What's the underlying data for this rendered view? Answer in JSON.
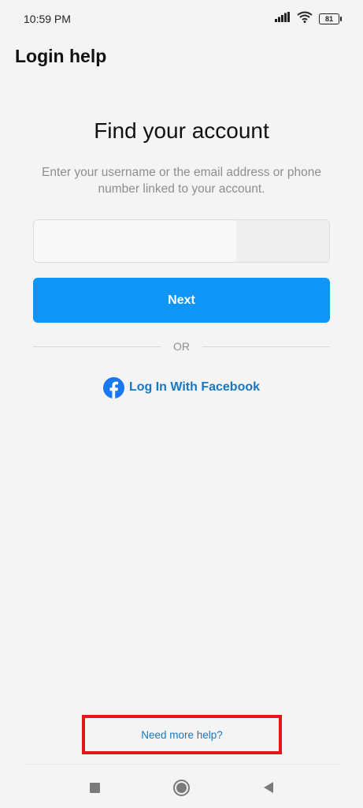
{
  "status_bar": {
    "time": "10:59 PM",
    "battery": "81",
    "icons": [
      "signal-icon",
      "wifi-icon",
      "battery-icon"
    ]
  },
  "header": {
    "title": "Login help"
  },
  "main": {
    "title": "Find your account",
    "subtitle": "Enter your username or the email address or phone number linked to your account.",
    "input": {
      "value": "",
      "placeholder": ""
    },
    "next_label": "Next",
    "divider_text": "OR",
    "facebook_label": "Log In With Facebook"
  },
  "footer": {
    "help_label": "Need more help?"
  },
  "nav": {
    "icons": [
      "recents-square-icon",
      "home-circle-icon",
      "back-triangle-icon"
    ]
  },
  "colors": {
    "background": "#f4f4f4",
    "primary": "#0f95f6",
    "link": "#1877c2",
    "facebook": "#1877f2",
    "highlight_box": "#e8141c",
    "muted_text": "#8e8e8e"
  }
}
